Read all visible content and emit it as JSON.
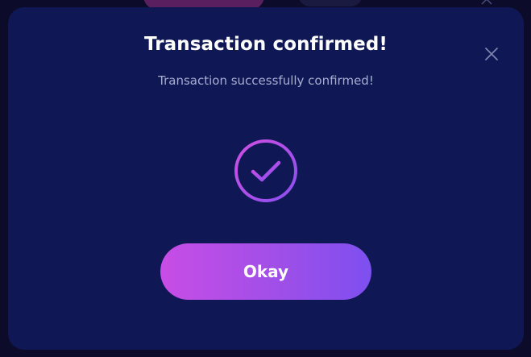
{
  "modal": {
    "title": "Transaction confirmed!",
    "subtitle": "Transaction successfully confirmed!",
    "close_icon": "close-icon",
    "status_icon": "check-circle-icon",
    "ok_label": "Okay"
  },
  "colors": {
    "modal_background": "#0f1855",
    "title_text": "#ffffff",
    "subtitle_text": "#a7add1",
    "accent_pink": "#c84de6",
    "accent_purple": "#7e4ff0"
  }
}
